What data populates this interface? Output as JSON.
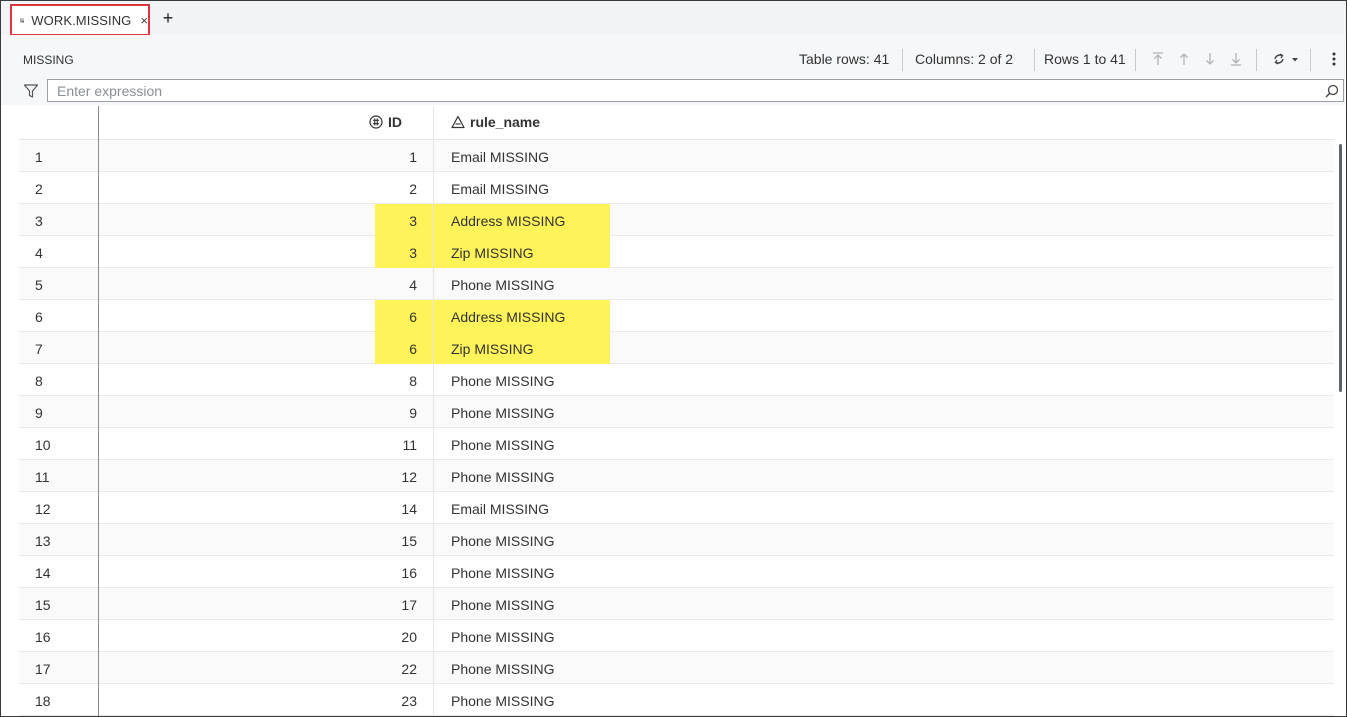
{
  "tab": {
    "label": "WORK.MISSING",
    "close_glyph": "×",
    "icon": "table-icon"
  },
  "add_tab_glyph": "+",
  "toolbar": {
    "table_name": "MISSING",
    "table_rows": "Table rows: 41",
    "columns": "Columns: 2 of 2",
    "rows_range": "Rows 1 to 41",
    "icons": [
      "first-row-icon",
      "previous-row-icon",
      "next-row-icon",
      "last-row-icon",
      "refresh-icon",
      "more-options-icon"
    ]
  },
  "filter": {
    "placeholder": "Enter expression",
    "value": ""
  },
  "columns": [
    {
      "name": "ID",
      "icon": "numeric-column-icon"
    },
    {
      "name": "rule_name",
      "icon": "character-column-icon"
    }
  ],
  "highlight_color": "#fff35a",
  "rows": [
    {
      "n": "1",
      "id": "1",
      "rule": "Email MISSING",
      "highlight": false
    },
    {
      "n": "2",
      "id": "2",
      "rule": "Email MISSING",
      "highlight": false
    },
    {
      "n": "3",
      "id": "3",
      "rule": "Address MISSING",
      "highlight": true
    },
    {
      "n": "4",
      "id": "3",
      "rule": "Zip MISSING",
      "highlight": true
    },
    {
      "n": "5",
      "id": "4",
      "rule": "Phone MISSING",
      "highlight": false
    },
    {
      "n": "6",
      "id": "6",
      "rule": "Address MISSING",
      "highlight": true
    },
    {
      "n": "7",
      "id": "6",
      "rule": "Zip MISSING",
      "highlight": true
    },
    {
      "n": "8",
      "id": "8",
      "rule": "Phone MISSING",
      "highlight": false
    },
    {
      "n": "9",
      "id": "9",
      "rule": "Phone MISSING",
      "highlight": false
    },
    {
      "n": "10",
      "id": "11",
      "rule": "Phone MISSING",
      "highlight": false
    },
    {
      "n": "11",
      "id": "12",
      "rule": "Phone MISSING",
      "highlight": false
    },
    {
      "n": "12",
      "id": "14",
      "rule": "Email MISSING",
      "highlight": false
    },
    {
      "n": "13",
      "id": "15",
      "rule": "Phone MISSING",
      "highlight": false
    },
    {
      "n": "14",
      "id": "16",
      "rule": "Phone MISSING",
      "highlight": false
    },
    {
      "n": "15",
      "id": "17",
      "rule": "Phone MISSING",
      "highlight": false
    },
    {
      "n": "16",
      "id": "20",
      "rule": "Phone MISSING",
      "highlight": false
    },
    {
      "n": "17",
      "id": "22",
      "rule": "Phone MISSING",
      "highlight": false
    },
    {
      "n": "18",
      "id": "23",
      "rule": "Phone MISSING",
      "highlight": false
    }
  ]
}
